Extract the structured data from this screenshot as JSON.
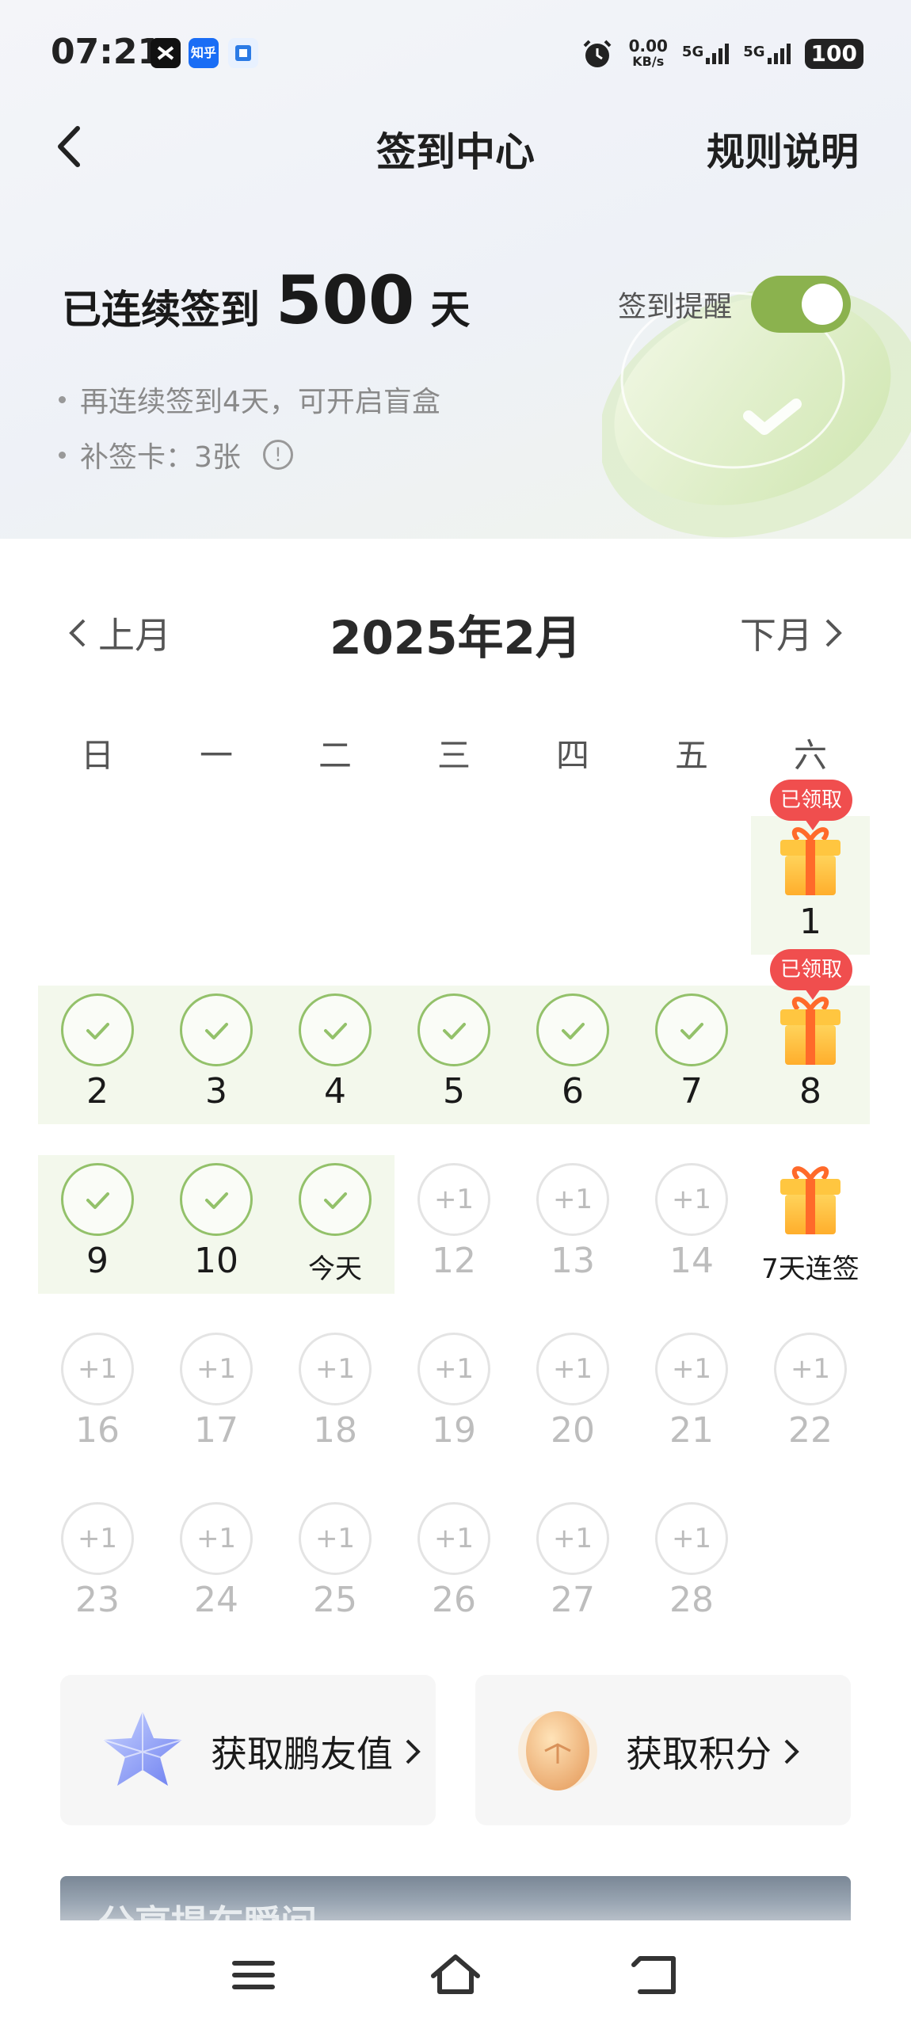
{
  "status_bar": {
    "time": "07:21",
    "apps": [
      "capcut-icon",
      "zhihu-icon",
      "app-icon"
    ],
    "zhihu_label": "知乎",
    "net_speed": "0.00",
    "net_unit": "KB/s",
    "signal_1": "5G",
    "signal_2": "5G",
    "battery": "100"
  },
  "nav": {
    "title": "签到中心",
    "rules": "规则说明"
  },
  "summary": {
    "prefix": "已连续签到",
    "days": "500",
    "suffix": "天",
    "reminder_label": "签到提醒",
    "reminder_on": true,
    "tip_1": "再连续签到4天，可开启盲盒",
    "tip_2": "补签卡：3张"
  },
  "calendar": {
    "prev": "上月",
    "next": "下月",
    "month": "2025年2月",
    "weekdays": [
      "日",
      "一",
      "二",
      "三",
      "四",
      "五",
      "六"
    ],
    "claimed_label": "已领取",
    "plus_label": "+1",
    "days": [
      {
        "label": "1",
        "state": "gift-claimed"
      },
      {
        "label": "2",
        "state": "checked"
      },
      {
        "label": "3",
        "state": "checked"
      },
      {
        "label": "4",
        "state": "checked"
      },
      {
        "label": "5",
        "state": "checked"
      },
      {
        "label": "6",
        "state": "checked"
      },
      {
        "label": "7",
        "state": "checked"
      },
      {
        "label": "8",
        "state": "gift-claimed"
      },
      {
        "label": "9",
        "state": "checked"
      },
      {
        "label": "10",
        "state": "checked"
      },
      {
        "label": "今天",
        "state": "checked"
      },
      {
        "label": "12",
        "state": "pending"
      },
      {
        "label": "13",
        "state": "pending"
      },
      {
        "label": "14",
        "state": "pending"
      },
      {
        "label": "7天连签",
        "state": "gift"
      },
      {
        "label": "16",
        "state": "pending"
      },
      {
        "label": "17",
        "state": "pending"
      },
      {
        "label": "18",
        "state": "pending"
      },
      {
        "label": "19",
        "state": "pending"
      },
      {
        "label": "20",
        "state": "pending"
      },
      {
        "label": "21",
        "state": "pending"
      },
      {
        "label": "22",
        "state": "pending"
      },
      {
        "label": "23",
        "state": "pending"
      },
      {
        "label": "24",
        "state": "pending"
      },
      {
        "label": "25",
        "state": "pending"
      },
      {
        "label": "26",
        "state": "pending"
      },
      {
        "label": "27",
        "state": "pending"
      },
      {
        "label": "28",
        "state": "pending"
      }
    ]
  },
  "rewards": {
    "friend_value": "获取鹏友值",
    "points": "获取积分"
  },
  "banner": {
    "text": "分享提车瞬间"
  },
  "colors": {
    "accent_green": "#8bb24e",
    "check_green": "#93c16a",
    "badge_red": "#f04e4e"
  }
}
